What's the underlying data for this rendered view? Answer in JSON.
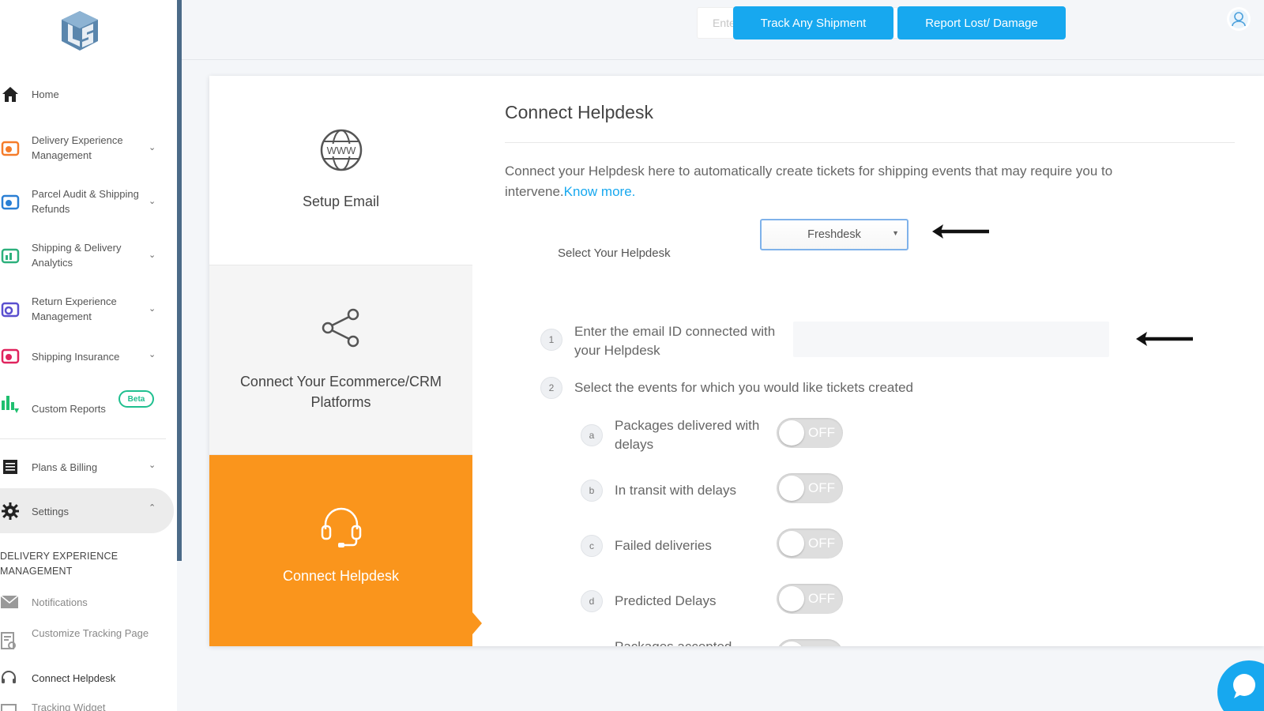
{
  "topbar": {
    "tracking_placeholder": "Enter Your Tracking Number",
    "track_button": "Track Any Shipment",
    "report_button": "Report Lost/ Damage"
  },
  "sidebar": {
    "items": [
      {
        "label": "Home",
        "icon": "home-icon"
      },
      {
        "label": "Delivery Experience Management",
        "icon": "delivery-icon"
      },
      {
        "label": "Parcel Audit & Shipping Refunds",
        "icon": "refund-icon"
      },
      {
        "label": "Shipping & Delivery Analytics",
        "icon": "analytics-icon"
      },
      {
        "label": "Return Experience Management",
        "icon": "return-icon"
      },
      {
        "label": "Shipping Insurance",
        "icon": "insurance-icon"
      },
      {
        "label": "Custom Reports",
        "icon": "reports-icon",
        "badge": "Beta"
      },
      {
        "label": "Plans & Billing",
        "icon": "billing-icon"
      },
      {
        "label": "Settings",
        "icon": "gear-icon"
      }
    ],
    "section_heading": "DELIVERY EXPERIENCE MANAGEMENT",
    "sub_items": [
      {
        "label": "Notifications",
        "icon": "mail-icon"
      },
      {
        "label": "Customize Tracking Page",
        "icon": "tracking-page-icon"
      },
      {
        "label": "Connect Helpdesk",
        "icon": "headset-icon"
      },
      {
        "label": "Tracking Widget",
        "icon": "widget-icon"
      }
    ]
  },
  "steps": [
    {
      "label": "Setup Email",
      "icon": "globe-www-icon"
    },
    {
      "label": "Connect Your Ecommerce/CRM Platforms",
      "icon": "share-icon"
    },
    {
      "label": "Connect Helpdesk",
      "icon": "headset-icon"
    }
  ],
  "content": {
    "title": "Connect Helpdesk",
    "description": "Connect your Helpdesk here to automatically create tickets for shipping events that may require you to intervene.",
    "know_more": "Know more.",
    "select_label": "Select Your Helpdesk",
    "selected_helpdesk": "Freshdesk",
    "q1_num": "1",
    "q1_text": "Enter the email ID connected with your Helpdesk",
    "q2_num": "2",
    "q2_text": "Select the events for which you would like tickets created",
    "events": [
      {
        "letter": "a",
        "label": "Packages delivered with delays",
        "state": "OFF"
      },
      {
        "letter": "b",
        "label": "In transit with delays",
        "state": "OFF"
      },
      {
        "letter": "c",
        "label": "Failed deliveries",
        "state": "OFF"
      },
      {
        "letter": "d",
        "label": "Predicted Delays",
        "state": "OFF"
      },
      {
        "letter": "",
        "label": "Packages accepted",
        "state": "OFF"
      }
    ]
  },
  "colors": {
    "accent_blue": "#17a8ef",
    "active_orange": "#fa951c",
    "beta_green": "#1fbf8f"
  }
}
